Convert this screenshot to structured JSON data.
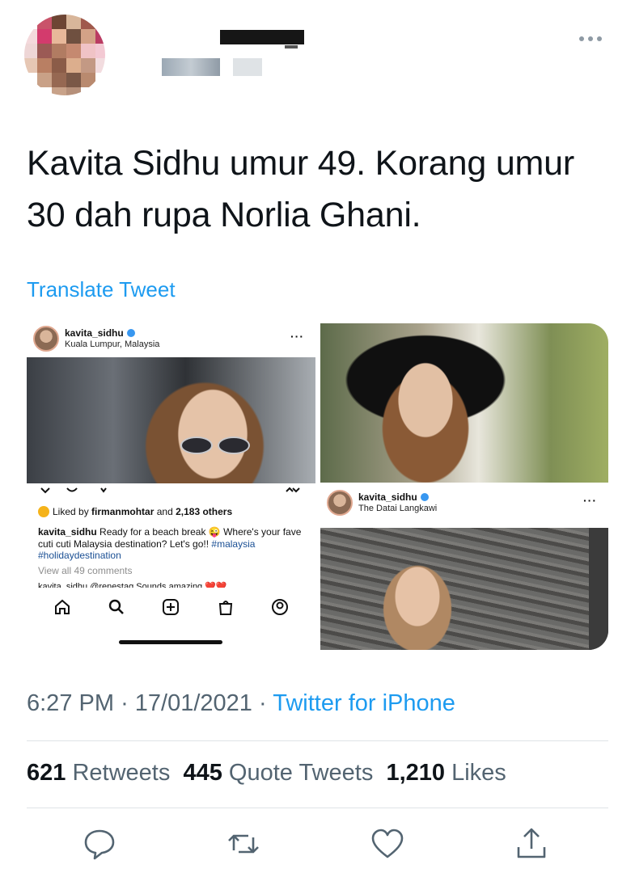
{
  "tweet": {
    "text": "Kavita Sidhu umur 49. Korang umur 30 dah rupa Norlia Ghani.",
    "translate_label": "Translate Tweet",
    "time": "6:27 PM",
    "date": "17/01/2021",
    "source": "Twitter for iPhone",
    "separator": "·"
  },
  "stats": {
    "retweets_count": "621",
    "retweets_label": "Retweets",
    "quotes_count": "445",
    "quotes_label": "Quote Tweets",
    "likes_count": "1,210",
    "likes_label": "Likes"
  },
  "media": {
    "post1": {
      "username": "kavita_sidhu",
      "location": "Kuala Lumpur, Malaysia",
      "more": "···",
      "liked_by_prefix": "Liked by",
      "liked_by_user": "firmanmohtar",
      "liked_by_mid": "and",
      "liked_by_count": "2,183 others",
      "caption_user": "kavita_sidhu",
      "caption_text": "Ready for a beach break 😜 Where's your fave cuti cuti Malaysia destination? Let's go!!",
      "hashtag1": "#malaysia",
      "hashtag2": "#holidaydestination",
      "view_comments": "View all 49 comments",
      "cut_comment": "kavita_sidhu @renestag Sounds amazing ❤️❤️"
    },
    "post2": {
      "username": "kavita_sidhu",
      "location": "The Datai Langkawi",
      "more": "···"
    }
  },
  "icons": {
    "header_more": "more-icon",
    "reply": "reply-icon",
    "retweet": "retweet-icon",
    "like": "heart-icon",
    "share": "share-icon"
  },
  "colors": {
    "link": "#1d9bf0",
    "secondary": "#536471",
    "text": "#0f1419"
  }
}
